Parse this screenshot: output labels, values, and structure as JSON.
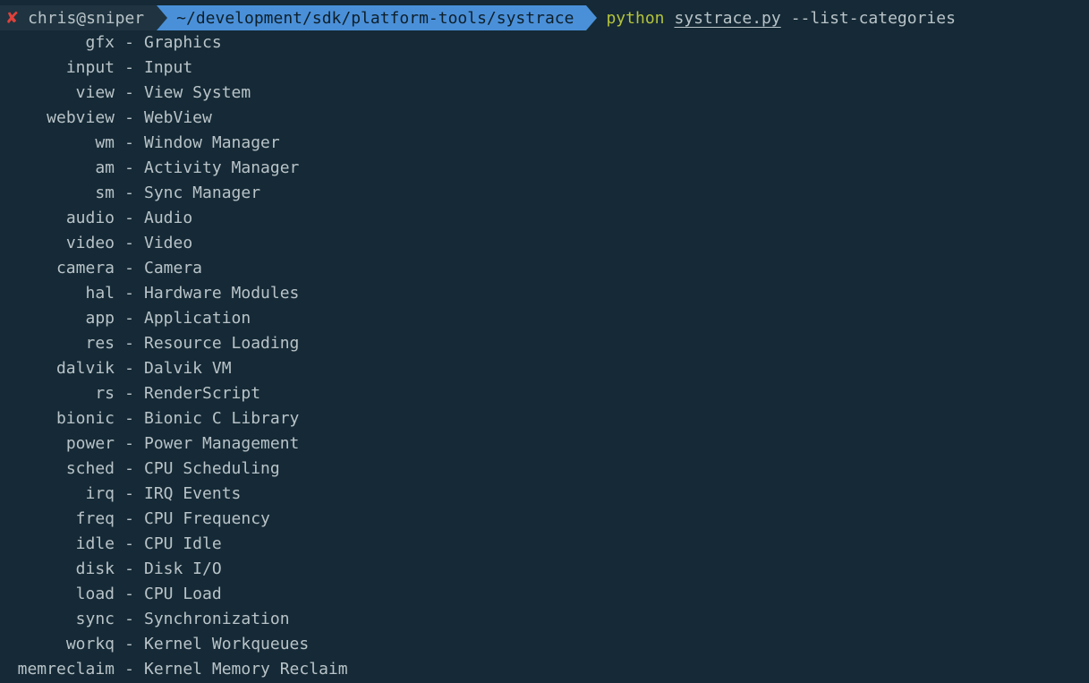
{
  "prompt": {
    "status_icon": "✘",
    "user_host": "chris@sniper",
    "path": "~/development/sdk/platform-tools/systrace",
    "command": {
      "program": "python",
      "script": "systrace.py",
      "args": "--list-categories"
    }
  },
  "separator": "-",
  "categories": [
    {
      "key": "gfx",
      "desc": "Graphics"
    },
    {
      "key": "input",
      "desc": "Input"
    },
    {
      "key": "view",
      "desc": "View System"
    },
    {
      "key": "webview",
      "desc": "WebView"
    },
    {
      "key": "wm",
      "desc": "Window Manager"
    },
    {
      "key": "am",
      "desc": "Activity Manager"
    },
    {
      "key": "sm",
      "desc": "Sync Manager"
    },
    {
      "key": "audio",
      "desc": "Audio"
    },
    {
      "key": "video",
      "desc": "Video"
    },
    {
      "key": "camera",
      "desc": "Camera"
    },
    {
      "key": "hal",
      "desc": "Hardware Modules"
    },
    {
      "key": "app",
      "desc": "Application"
    },
    {
      "key": "res",
      "desc": "Resource Loading"
    },
    {
      "key": "dalvik",
      "desc": "Dalvik VM"
    },
    {
      "key": "rs",
      "desc": "RenderScript"
    },
    {
      "key": "bionic",
      "desc": "Bionic C Library"
    },
    {
      "key": "power",
      "desc": "Power Management"
    },
    {
      "key": "sched",
      "desc": "CPU Scheduling"
    },
    {
      "key": "irq",
      "desc": "IRQ Events"
    },
    {
      "key": "freq",
      "desc": "CPU Frequency"
    },
    {
      "key": "idle",
      "desc": "CPU Idle"
    },
    {
      "key": "disk",
      "desc": "Disk I/O"
    },
    {
      "key": "load",
      "desc": "CPU Load"
    },
    {
      "key": "sync",
      "desc": "Synchronization"
    },
    {
      "key": "workq",
      "desc": "Kernel Workqueues"
    },
    {
      "key": "memreclaim",
      "desc": "Kernel Memory Reclaim"
    }
  ],
  "colors": {
    "background": "#152a36",
    "text": "#b9c3c8",
    "path_segment": "#4a90d9",
    "error_icon": "#e0413a",
    "command": "#b5c33b"
  }
}
